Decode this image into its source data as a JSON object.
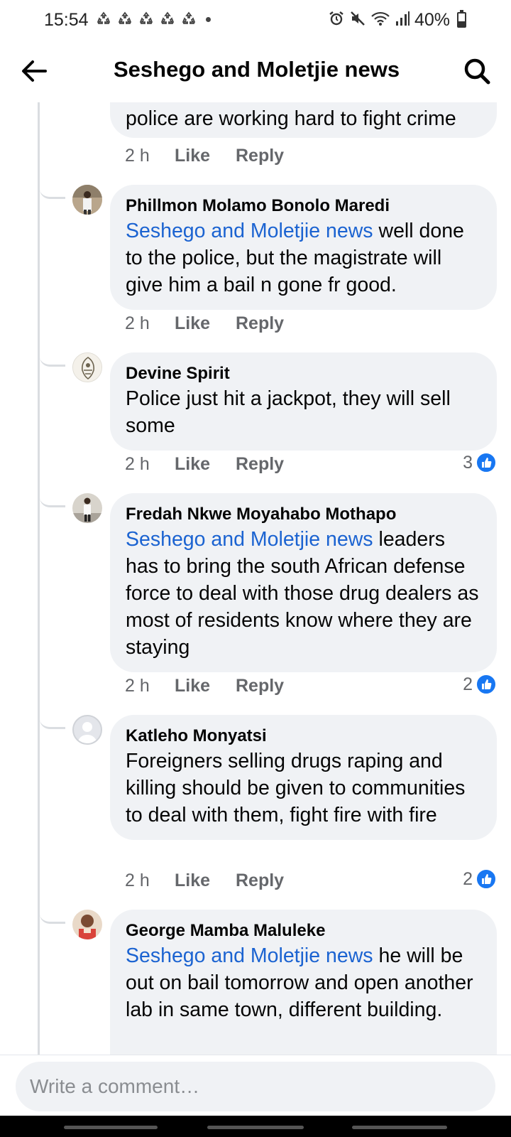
{
  "status_bar": {
    "time": "15:54",
    "battery_percent": "40%",
    "battery_level": 0.4,
    "icons": [
      "recycle-icon",
      "recycle-icon",
      "recycle-icon",
      "recycle-icon",
      "recycle-icon",
      "dot-icon",
      "alarm-icon",
      "mute-icon",
      "wifi-icon",
      "signal-icon",
      "battery-icon"
    ]
  },
  "header": {
    "title": "Seshego and Moletjie news",
    "back_icon": "back-arrow-icon",
    "search_icon": "search-icon"
  },
  "comments": [
    {
      "author": "",
      "mention": "",
      "text": "police are working hard to fight crime",
      "time": "2 h",
      "like_label": "Like",
      "reply_label": "Reply",
      "reaction_count": ""
    },
    {
      "author": "Phillmon Molamo Bonolo Maredi",
      "mention": "Seshego and Moletjie news",
      "text": " well done to the police, but the magistrate will give him a bail n gone fr good.",
      "time": "2 h",
      "like_label": "Like",
      "reply_label": "Reply",
      "reaction_count": ""
    },
    {
      "author": "Devine Spirit",
      "mention": "",
      "text": "Police just hit a jackpot, they will sell some",
      "time": "2 h",
      "like_label": "Like",
      "reply_label": "Reply",
      "reaction_count": "3"
    },
    {
      "author": "Fredah Nkwe Moyahabo Mothapo",
      "mention": "Seshego and Moletjie news",
      "text": " leaders has to bring the south African defense force to deal with those drug dealers as most of residents know where they are staying",
      "time": "2 h",
      "like_label": "Like",
      "reply_label": "Reply",
      "reaction_count": "2"
    },
    {
      "author": "Katleho Monyatsi",
      "mention": "",
      "text": "Foreigners selling drugs raping and killing should be given to communities to deal with them, fight fire with fire",
      "time": "2 h",
      "like_label": "Like",
      "reply_label": "Reply",
      "reaction_count": "2"
    },
    {
      "author": "George Mamba Maluleke",
      "mention": "Seshego and Moletjie news",
      "text": " he will be out on bail tomorrow and open another lab in same town, different building.",
      "time": "",
      "like_label": "",
      "reply_label": "",
      "reaction_count": ""
    }
  ],
  "composer": {
    "placeholder": "Write a comment…"
  },
  "colors": {
    "mention": "#1b63d1",
    "bubble": "#f0f2f5",
    "like_badge": "#1877f2",
    "meta_text": "#65676b"
  }
}
